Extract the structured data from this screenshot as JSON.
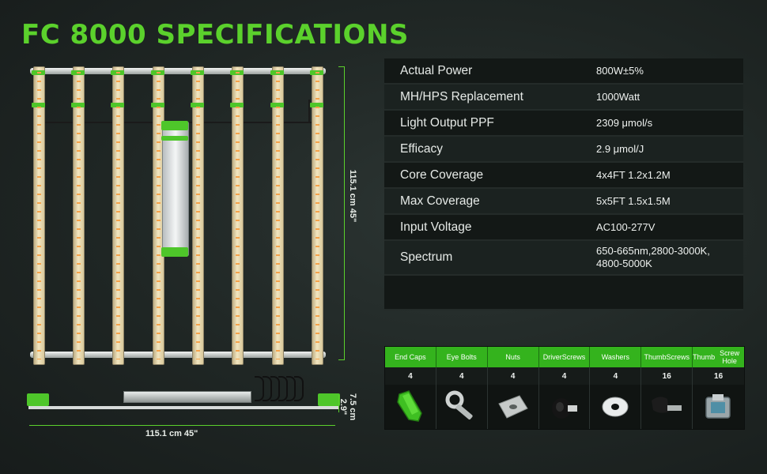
{
  "title": "FC 8000 SPECIFICATIONS",
  "dimensions": {
    "height_label": "115.1 cm   45\"",
    "width_label": "115.1 cm   45\"",
    "depth_label_cm": "7.5 cm",
    "depth_label_in": "2.9\""
  },
  "specs": [
    {
      "label": "Actual Power",
      "value": "800W±5%"
    },
    {
      "label": "MH/HPS Replacement",
      "value": "1000Watt"
    },
    {
      "label": "Light Output PPF",
      "value": "2309 μmol/s"
    },
    {
      "label": "Efficacy",
      "value": "2.9  μmol/J"
    },
    {
      "label": "Core Coverage",
      "value": "4x4FT 1.2x1.2M"
    },
    {
      "label": "Max Coverage",
      "value": "5x5FT 1.5x1.5M"
    },
    {
      "label": "Input Voltage",
      "value": "AC100-277V"
    },
    {
      "label": "Spectrum",
      "value_line1": "650-665nm,2800-3000K,",
      "value_line2": "4800-5000K"
    }
  ],
  "accessories": [
    {
      "name": "End Caps",
      "qty": "4",
      "icon": "end-cap-icon"
    },
    {
      "name": "Eye Bolts",
      "qty": "4",
      "icon": "eye-bolt-icon"
    },
    {
      "name": "Nuts",
      "qty": "4",
      "icon": "nut-icon"
    },
    {
      "name_line1": "Driver",
      "name_line2": "Screws",
      "qty": "4",
      "icon": "driver-screw-icon"
    },
    {
      "name": "Washers",
      "qty": "4",
      "icon": "washer-icon"
    },
    {
      "name_line1": "Thumb",
      "name_line2": "Screws",
      "qty": "16",
      "icon": "thumb-screw-icon"
    },
    {
      "name_line1": "Thumb",
      "name_line2": "Screw Hole",
      "qty": "16",
      "icon": "thumb-screw-hole-icon"
    }
  ],
  "colors": {
    "accent": "#5bd12c",
    "header_green": "#34b31d"
  }
}
